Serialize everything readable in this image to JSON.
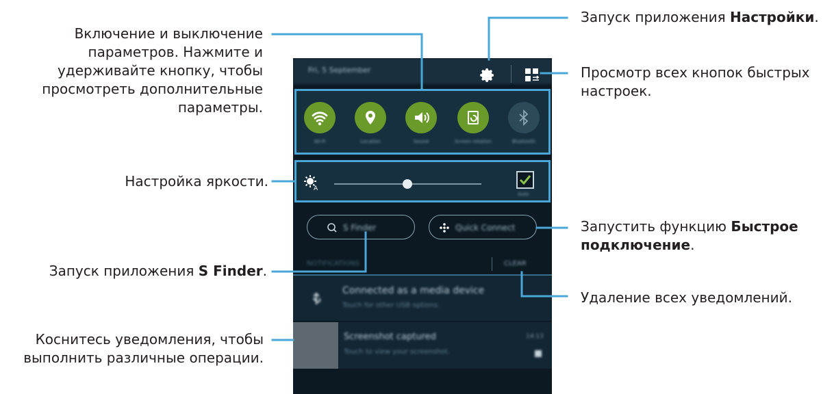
{
  "annotations": {
    "toggle": {
      "lines": [
        "Включение и выключение",
        "параметров. Нажмите и",
        "удерживайте кнопку, чтобы",
        "просмотреть дополнительные",
        "параметры."
      ]
    },
    "brightness": "Настройка яркости.",
    "sfinder": {
      "prefix": "Запуск приложения ",
      "bold": "S Finder",
      "suffix": "."
    },
    "notification": {
      "lines": [
        "Коснитесь уведомления, чтобы",
        "выполнить различные операции."
      ]
    },
    "settings": {
      "prefix": "Запуск приложения ",
      "bold": "Настройки",
      "suffix": "."
    },
    "all_buttons": {
      "lines": [
        "Просмотр всех кнопок быстрых",
        "настроек."
      ]
    },
    "quick_connect": {
      "prefix": "Запустить функцию ",
      "bold1": "Быстрое",
      "bold2": "подключение",
      "suffix": "."
    },
    "clear": "Удаление всех уведомлений."
  },
  "phone": {
    "date": "Fri, 5 September",
    "quick_settings": [
      {
        "label": "Wi-Fi",
        "icon": "wifi-icon",
        "on": true
      },
      {
        "label": "Location",
        "icon": "location-icon",
        "on": true
      },
      {
        "label": "Sound",
        "icon": "sound-icon",
        "on": true
      },
      {
        "label": "Screen rotation",
        "icon": "rotation-icon",
        "on": true
      },
      {
        "label": "Bluetooth",
        "icon": "bluetooth-icon",
        "on": false
      }
    ],
    "brightness_auto": "Auto",
    "s_finder": "S Finder",
    "quick_connect": "Quick Connect",
    "notifications_header": "NOTIFICATIONS",
    "clear": "CLEAR",
    "notifications": [
      {
        "title": "Connected as a media device",
        "subtitle": "Touch for other USB options."
      },
      {
        "title": "Screenshot captured",
        "subtitle": "Touch to view your screenshot.",
        "time": "14:13"
      }
    ],
    "colors": {
      "accent": "#4aa7d8",
      "toggle_on": "#6a9a2a",
      "background": "#0c1922"
    }
  }
}
